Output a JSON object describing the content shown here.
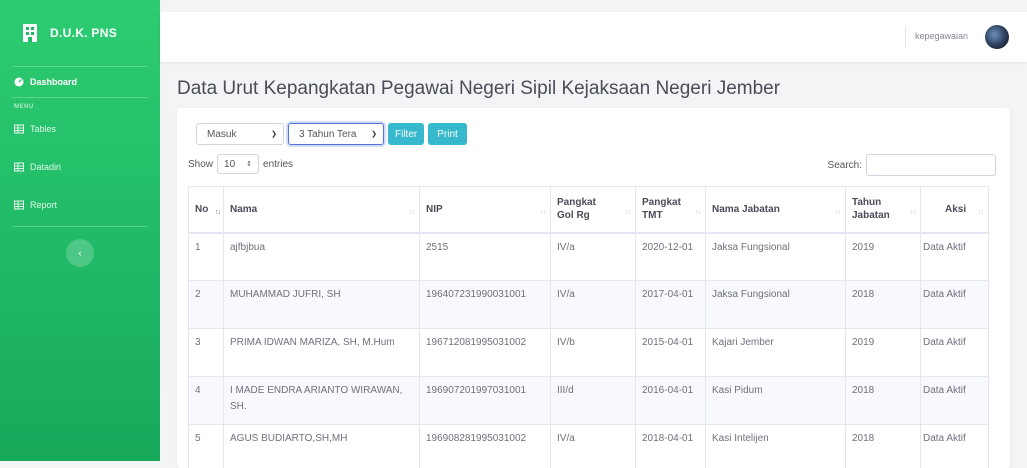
{
  "sidebar": {
    "brand": "D.U.K. PNS",
    "dashboard_label": "Dashboard",
    "menu_heading": "MENU",
    "items": [
      {
        "label": "Tables",
        "icon": "table-icon"
      },
      {
        "label": "Datadiri",
        "icon": "table-icon"
      },
      {
        "label": "Report",
        "icon": "table-icon"
      }
    ]
  },
  "topbar": {
    "user_name": "kepegawaian"
  },
  "page": {
    "title": "Data Urut Kepangkatan Pegawai Negeri Sipil Kejaksaan Negeri Jember"
  },
  "filters": {
    "status_value": "Masuk",
    "period_value": "3 Tahun Tera",
    "filter_label": "Filter",
    "print_label": "Print"
  },
  "table_controls": {
    "show_label": "Show",
    "entries_value": "10",
    "entries_label": "entries",
    "search_label": "Search:"
  },
  "table": {
    "headers": [
      "No",
      "Nama",
      "NIP",
      "Pangkat Gol Rg",
      "Pangkat TMT",
      "Nama Jabatan",
      "Tahun Jabatan",
      "Aksi"
    ],
    "rows": [
      [
        "1",
        "ajfbjbua",
        "2515",
        "IV/a",
        "2020-12-01",
        "Jaksa Fungsional",
        "2019",
        "Data Aktif"
      ],
      [
        "2",
        "MUHAMMAD JUFRI, SH",
        "196407231990031001",
        "IV/a",
        "2017-04-01",
        "Jaksa Fungsional",
        "2018",
        "Data Aktif"
      ],
      [
        "3",
        "PRIMA IDWAN MARIZA, SH, M.Hum",
        "196712081995031002",
        "IV/b",
        "2015-04-01",
        "Kajari Jember",
        "2019",
        "Data Aktif"
      ],
      [
        "4",
        "I MADE ENDRA ARIANTO WIRAWAN, SH.",
        "196907201997031001",
        "III/d",
        "2016-04-01",
        "Kasi Pidum",
        "2018",
        "Data Aktif"
      ],
      [
        "5",
        "AGUS BUDIARTO,SH,MH",
        "196908281995031002",
        "IV/a",
        "2018-04-01",
        "Kasi Intelijen",
        "2018",
        "Data Aktif"
      ]
    ]
  },
  "colors": {
    "sidebar": "#1fb866",
    "accent": "#36b9cc",
    "focus": "#4e73df"
  }
}
